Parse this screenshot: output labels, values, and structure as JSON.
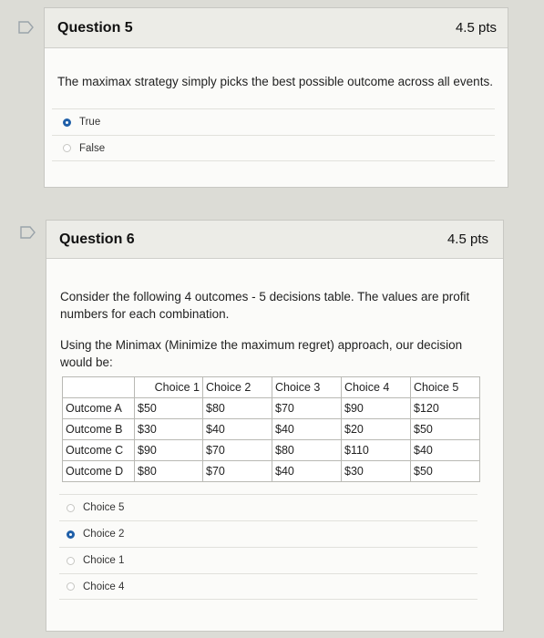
{
  "q5": {
    "title": "Question 5",
    "points": "4.5 pts",
    "text": "The maximax strategy simply picks the best possible outcome across all events.",
    "answers": [
      {
        "label": "True",
        "selected": true
      },
      {
        "label": "False",
        "selected": false
      }
    ]
  },
  "q6": {
    "title": "Question 6",
    "points": "4.5 pts",
    "text1": "Consider the following 4 outcomes -  5 decisions table. The values are profit numbers for each combination.",
    "text2": "Using the Minimax (Minimize the maximum regret) approach, our decision would be:",
    "table": {
      "headers": [
        "",
        "Choice 1",
        "Choice 2",
        "Choice 3",
        "Choice 4",
        "Choice 5"
      ],
      "rows": [
        [
          "Outcome A",
          "$50",
          "$80",
          "$70",
          "$90",
          "$120"
        ],
        [
          "Outcome B",
          "$30",
          "$40",
          "$40",
          "$20",
          "$50"
        ],
        [
          "Outcome C",
          "$90",
          "$70",
          "$80",
          "$110",
          "$40"
        ],
        [
          "Outcome D",
          "$80",
          "$70",
          "$40",
          "$30",
          "$50"
        ]
      ]
    },
    "answers": [
      {
        "label": "Choice 5",
        "selected": false
      },
      {
        "label": "Choice 2",
        "selected": true
      },
      {
        "label": "Choice 1",
        "selected": false
      },
      {
        "label": "Choice 4",
        "selected": false
      }
    ]
  },
  "icons": {
    "flag": "bookmark-flag-icon"
  },
  "colors": {
    "selected_radio": "#1f5fa8",
    "header_bg": "#ecece7"
  }
}
